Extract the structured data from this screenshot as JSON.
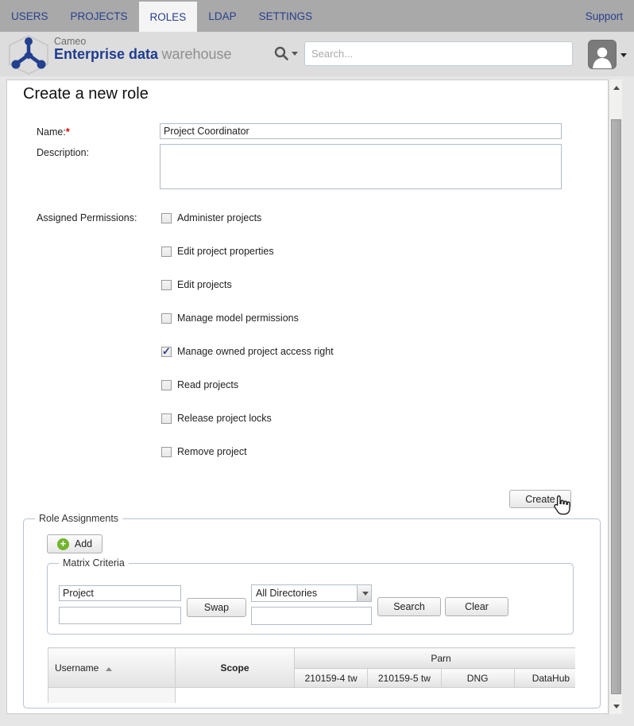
{
  "nav": {
    "items": [
      {
        "label": "USERS",
        "active": false
      },
      {
        "label": "PROJECTS",
        "active": false
      },
      {
        "label": "ROLES",
        "active": true
      },
      {
        "label": "LDAP",
        "active": false
      },
      {
        "label": "SETTINGS",
        "active": false
      }
    ],
    "support_label": "Support"
  },
  "header": {
    "brand_line1": "Cameo",
    "brand_strong": "Enterprise data",
    "brand_light": "warehouse",
    "search_placeholder": "Search..."
  },
  "form": {
    "title": "Create a new role",
    "name_label": "Name:",
    "required_marker": "*",
    "name_value": "Project Coordinator",
    "description_label": "Description:",
    "description_value": "",
    "permissions_label": "Assigned Permissions:",
    "permissions": [
      {
        "label": "Administer projects",
        "checked": false
      },
      {
        "label": "Edit project properties",
        "checked": false
      },
      {
        "label": "Edit projects",
        "checked": false
      },
      {
        "label": "Manage model permissions",
        "checked": false
      },
      {
        "label": "Manage owned project access right",
        "checked": true
      },
      {
        "label": "Read projects",
        "checked": false
      },
      {
        "label": "Release project locks",
        "checked": false
      },
      {
        "label": "Remove project",
        "checked": false
      }
    ],
    "create_button_label": "Create"
  },
  "role_assignments": {
    "legend": "Role Assignments",
    "add_button_label": "Add",
    "matrix_criteria": {
      "legend": "Matrix Criteria",
      "row_type_value": "Project",
      "row_filter_value": "",
      "swap_button_label": "Swap",
      "directory_selected": "All Directories",
      "column_filter_value": "",
      "search_button_label": "Search",
      "clear_button_label": "Clear"
    },
    "table": {
      "username_header": "Username",
      "scope_header": "Scope",
      "group_header": "Parn",
      "columns": [
        "210159-4 tw",
        "210159-5 tw",
        "DNG",
        "DataHub"
      ]
    }
  },
  "icons": {
    "search": "magnifier",
    "user": "person-silhouette",
    "add": "plus-circle",
    "sort": "triangle-up",
    "pointer": "hand-cursor",
    "logo": "cameo-cube-network"
  },
  "colors": {
    "nav_bg": "#a9a9a9",
    "nav_text": "#27408e",
    "brand_blue": "#1f3d8f",
    "required_red": "#e00000",
    "add_green": "#72b42c",
    "check_blue": "#2b3b8f",
    "panel_bg": "#ffffff",
    "page_bg": "#e6e6e6"
  }
}
